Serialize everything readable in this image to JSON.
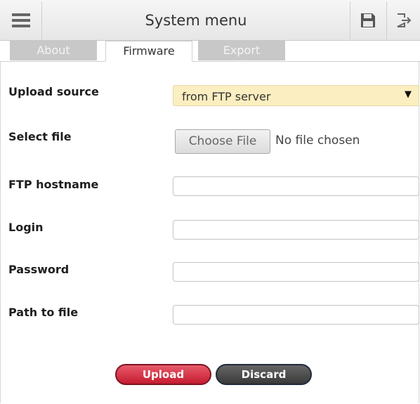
{
  "header": {
    "title": "System menu",
    "menu_icon": "hamburger-menu-icon",
    "save_icon": "floppy-disk-icon",
    "logout_icon": "logout-icon"
  },
  "tabs": [
    {
      "label": "About",
      "active": false
    },
    {
      "label": "Firmware",
      "active": true
    },
    {
      "label": "Export",
      "active": false
    }
  ],
  "form": {
    "upload_source": {
      "label": "Upload source",
      "value": "from FTP server"
    },
    "select_file": {
      "label": "Select file",
      "button": "Choose File",
      "status": "No file chosen"
    },
    "ftp_hostname": {
      "label": "FTP hostname",
      "value": ""
    },
    "login": {
      "label": "Login",
      "value": ""
    },
    "password": {
      "label": "Password",
      "value": ""
    },
    "path_to_file": {
      "label": "Path to file",
      "value": ""
    }
  },
  "actions": {
    "upload": "Upload",
    "discard": "Discard"
  },
  "colors": {
    "select_bg": "#fbeec0",
    "upload_button": "#d32f42",
    "discard_button": "#4a4a4a"
  }
}
